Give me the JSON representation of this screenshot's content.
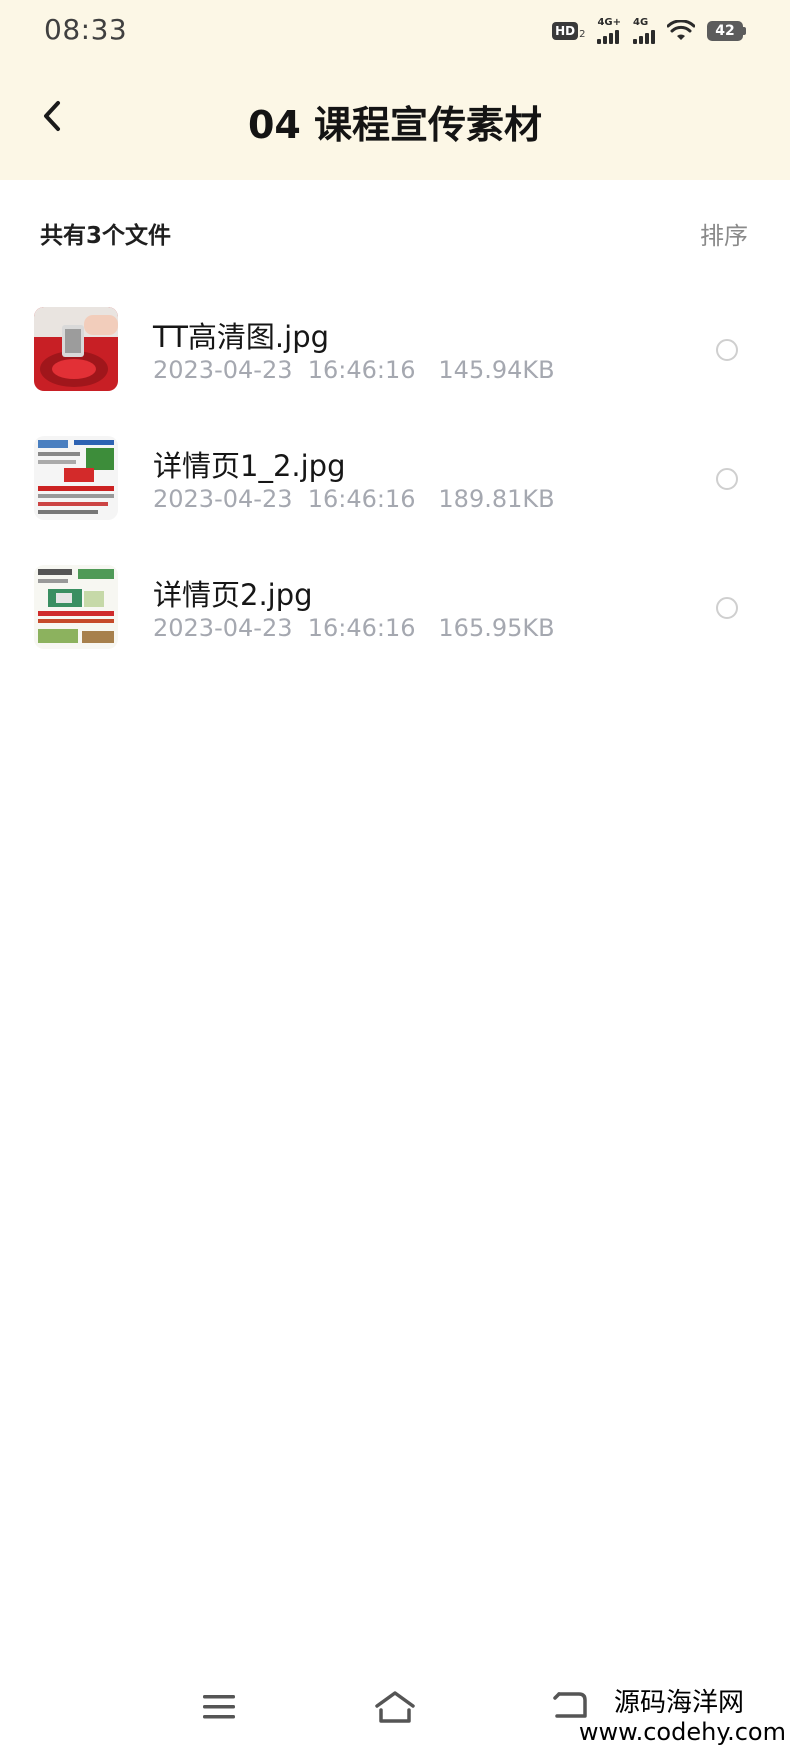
{
  "status_bar": {
    "time": "08:33",
    "hd_label": "HD",
    "hd_sub": "2",
    "net1_label": "4G+",
    "net2_label": "4G",
    "battery_level": "42"
  },
  "header": {
    "back_icon": "chevron-left-icon",
    "title": "04 课程宣传素材"
  },
  "summary": {
    "count_text": "共有3个文件",
    "sort_label": "排序"
  },
  "files": [
    {
      "name": "TT高清图.jpg",
      "meta": "2023-04-23  16:46:16   145.94KB",
      "selected": false
    },
    {
      "name": "详情页1_2.jpg",
      "meta": "2023-04-23  16:46:16   189.81KB",
      "selected": false
    },
    {
      "name": "详情页2.jpg",
      "meta": "2023-04-23  16:46:16   165.95KB",
      "selected": false
    }
  ],
  "nav": {
    "menu_icon": "menu-icon",
    "home_icon": "home-icon",
    "back_icon": "back-icon"
  },
  "watermark": {
    "cn": "源码海洋网",
    "url": "www.codehy.com"
  },
  "colors": {
    "header_bg": "#fcf7e6",
    "meta_text": "#a5a8b0",
    "accent_red": "#d3242a"
  }
}
